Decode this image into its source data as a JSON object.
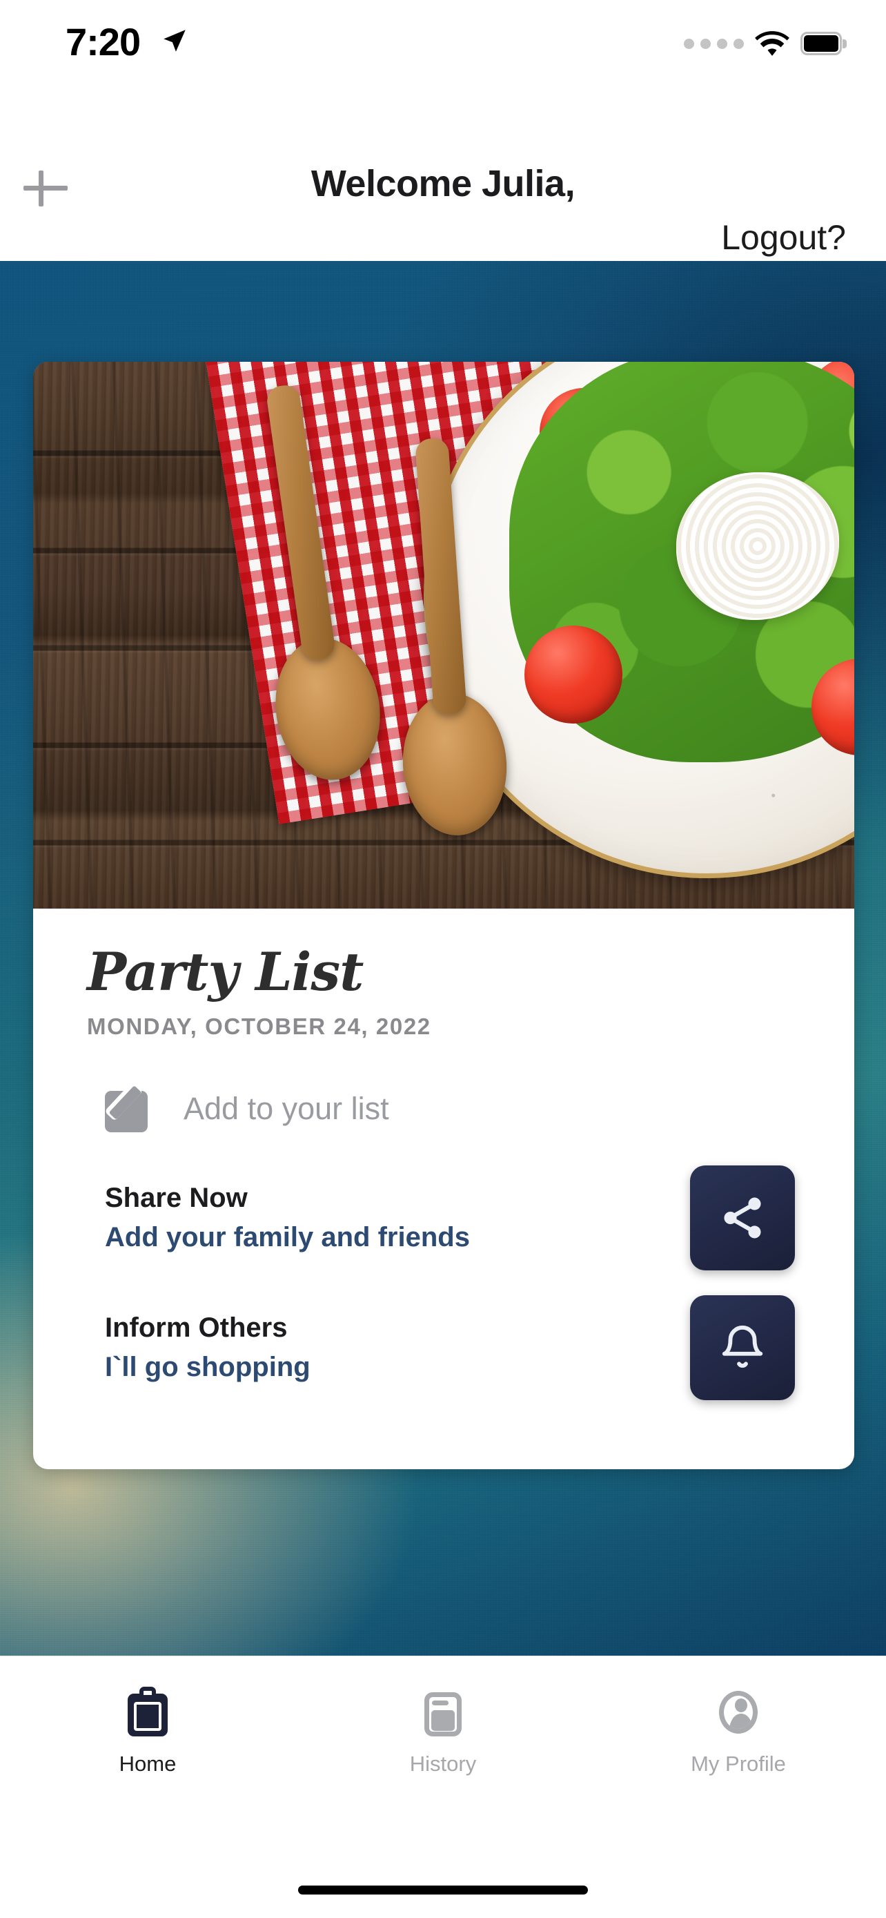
{
  "status_bar": {
    "time": "7:20",
    "location_icon": "location-arrow-icon",
    "signal_icon": "signal-dots-icon",
    "wifi_icon": "wifi-icon",
    "battery_icon": "battery-full-icon"
  },
  "header": {
    "add_icon": "plus-icon",
    "title": "Welcome Julia,",
    "logout_label": "Logout?"
  },
  "card": {
    "photo_alt": "salad-plate-photo",
    "list_title": "Party List",
    "list_date": "MONDAY, OCTOBER 24, 2022",
    "add_input": {
      "icon": "edit-pencil-icon",
      "placeholder": "Add to your list",
      "value": ""
    },
    "actions": [
      {
        "title": "Share Now",
        "subtitle": "Add your family and friends",
        "icon": "share-icon"
      },
      {
        "title": "Inform Others",
        "subtitle": "I`ll go shopping",
        "icon": "bell-icon"
      }
    ]
  },
  "tabbar": {
    "tabs": [
      {
        "label": "Home",
        "icon": "clipboard-icon",
        "active": true
      },
      {
        "label": "History",
        "icon": "history-card-icon",
        "active": false
      },
      {
        "label": "My Profile",
        "icon": "person-avatar-icon",
        "active": false
      }
    ]
  },
  "colors": {
    "accent_navy": "#232a49",
    "link_blue": "#2c4a72",
    "muted_gray": "#9a9ba0",
    "background_teal": "#1d6b7d"
  }
}
